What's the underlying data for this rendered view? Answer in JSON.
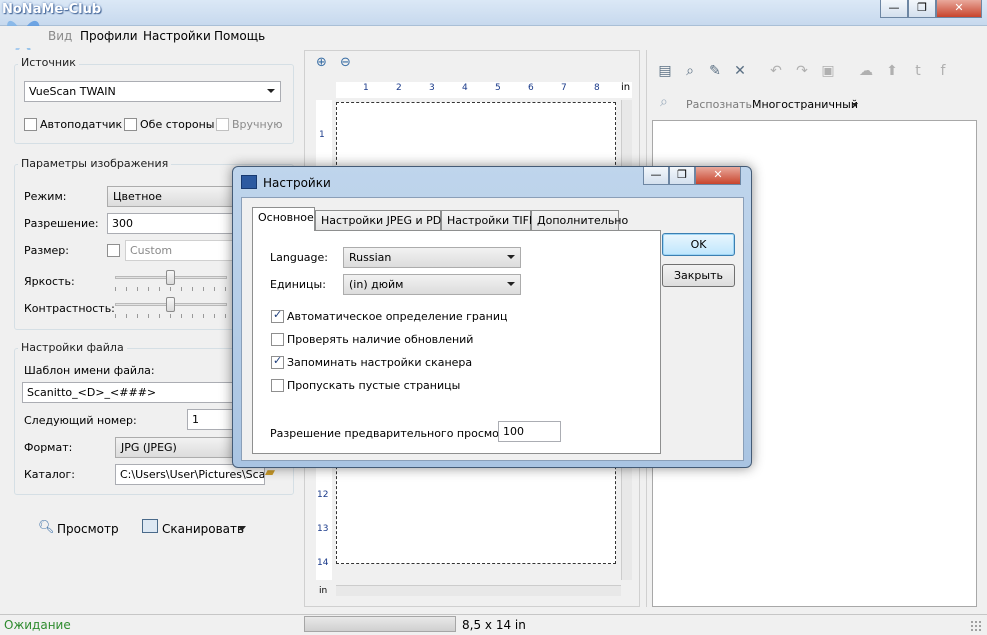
{
  "window": {
    "logo_text": "NoNaMe-Club",
    "caption_buttons": [
      "—",
      "❐",
      "✕"
    ]
  },
  "menu": [
    "Вид",
    "Профили",
    "Настройки",
    "Помощь"
  ],
  "source": {
    "legend": "Источник",
    "device": "VueScan TWAIN",
    "auto_feed": "Автоподатчик",
    "both_sides": "Обе стороны",
    "manual": "Вручную"
  },
  "image": {
    "legend": "Параметры изображения",
    "mode_label": "Режим:",
    "mode_value": "Цветное",
    "resolution_label": "Разрешение:",
    "resolution_value": "300",
    "size_label": "Размер:",
    "size_value": "Custom",
    "brightness_label": "Яркость:",
    "contrast_label": "Контрастность:"
  },
  "file": {
    "legend": "Настройки файла",
    "template_label": "Шаблон имени файла:",
    "template_value": "Scanitto_<D>_<###>",
    "next_label": "Следующий номер:",
    "next_value": "1",
    "format_label": "Формат:",
    "format_value": "JPG (JPEG)",
    "folder_label": "Каталог:",
    "folder_value": "C:\\Users\\User\\Pictures\\Scanitto"
  },
  "actions": {
    "preview": "Просмотр",
    "scan": "Сканировать"
  },
  "ruler": {
    "unit": "in",
    "top_numbers": [
      "1",
      "2",
      "3",
      "4",
      "5",
      "6",
      "7",
      "8"
    ],
    "left_numbers": [
      "1",
      "12",
      "13",
      "14"
    ]
  },
  "right": {
    "recognize": "Распознать",
    "multipage": "Многостраничный"
  },
  "status": {
    "state": "Ожидание",
    "size": "8,5 x 14 in"
  },
  "dialog": {
    "title": "Настройки",
    "tabs": [
      "Основное",
      "Настройки JPEG и PDF",
      "Настройки TIFF",
      "Дополнительно"
    ],
    "language_label": "Language:",
    "language_value": "Russian",
    "units_label": "Единицы:",
    "units_value": "(in) дюйм",
    "options": [
      {
        "label": "Автоматическое определение границ",
        "checked": true
      },
      {
        "label": "Проверять наличие обновлений",
        "checked": false
      },
      {
        "label": "Запоминать настройки сканера",
        "checked": true
      },
      {
        "label": "Пропускать пустые страницы",
        "checked": false
      }
    ],
    "preview_res_label": "Разрешение предварительного просмотра:",
    "preview_res_value": "100",
    "ok": "OK",
    "close": "Закрыть"
  },
  "colors": {
    "status_green": "#2e8b2e",
    "accent_blue": "#3c7fb1"
  }
}
